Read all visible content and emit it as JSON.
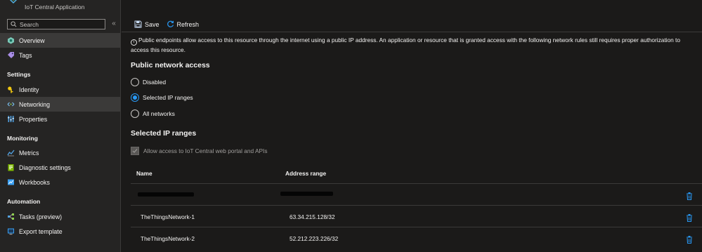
{
  "app": {
    "subtitle": "IoT Central Application"
  },
  "search": {
    "placeholder": "Search"
  },
  "sidebar": {
    "items": [
      {
        "label": "Overview",
        "icon": "overview-icon",
        "active": true
      },
      {
        "label": "Tags",
        "icon": "tag-icon"
      }
    ],
    "sections": [
      {
        "title": "Settings",
        "items": [
          {
            "label": "Identity",
            "icon": "key-icon"
          },
          {
            "label": "Networking",
            "icon": "network-icon",
            "active": true
          },
          {
            "label": "Properties",
            "icon": "properties-icon"
          }
        ]
      },
      {
        "title": "Monitoring",
        "items": [
          {
            "label": "Metrics",
            "icon": "metrics-icon"
          },
          {
            "label": "Diagnostic settings",
            "icon": "diagnostic-icon"
          },
          {
            "label": "Workbooks",
            "icon": "workbooks-icon"
          }
        ]
      },
      {
        "title": "Automation",
        "items": [
          {
            "label": "Tasks (preview)",
            "icon": "tasks-icon"
          },
          {
            "label": "Export template",
            "icon": "export-icon"
          }
        ]
      }
    ]
  },
  "toolbar": {
    "save_label": "Save",
    "refresh_label": "Refresh"
  },
  "info": "Public endpoints allow access to this resource through the internet using a public IP address. An application or resource that is granted access with the following network rules still requires proper authorization to access this resource.",
  "public_access": {
    "heading": "Public network access",
    "options": [
      "Disabled",
      "Selected IP ranges",
      "All networks"
    ],
    "selected": "Selected IP ranges"
  },
  "ip_ranges": {
    "heading": "Selected IP ranges",
    "allow_portal_label": "Allow access to IoT Central web portal and APIs",
    "allow_portal_checked": true,
    "columns": [
      "Name",
      "Address range"
    ],
    "rows": [
      {
        "name": "",
        "range": "",
        "redacted": true
      },
      {
        "name": "TheThingsNetwork-1",
        "range": "63.34.215.128/32"
      },
      {
        "name": "TheThingsNetwork-2",
        "range": "52.212.223.226/32"
      }
    ]
  },
  "colors": {
    "accent": "#2899f5",
    "background": "#1b1a19",
    "sidebar": "#252423",
    "active_item": "#3b3a39"
  }
}
